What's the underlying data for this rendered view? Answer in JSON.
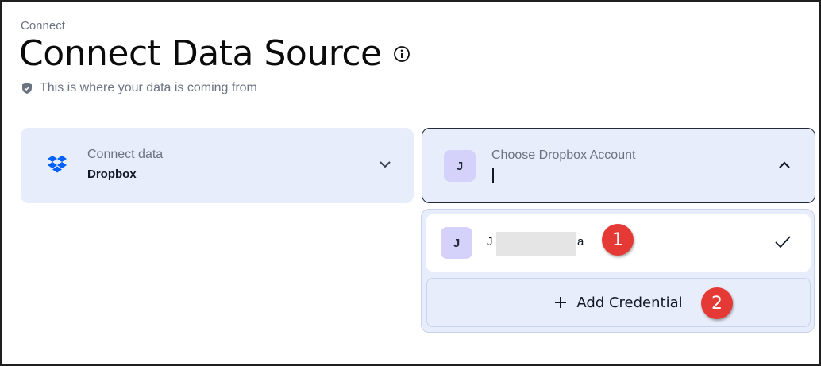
{
  "header": {
    "breadcrumb": "Connect",
    "title": "Connect Data Source",
    "subtitle": "This is where your data is coming from"
  },
  "source_card": {
    "label": "Connect data",
    "value": "Dropbox",
    "icon": "dropbox-icon"
  },
  "account_card": {
    "avatar_initial": "J",
    "label": "Choose Dropbox Account"
  },
  "dropdown": {
    "options": [
      {
        "avatar_initial": "J",
        "name_start": "J",
        "name_end": "a",
        "selected": true
      }
    ],
    "add_label": "Add Credential"
  },
  "annotations": [
    "1",
    "2"
  ],
  "colors": {
    "card_bg": "#e8edfb",
    "avatar_bg": "#d4d1fb",
    "dropbox_blue": "#0061fe",
    "badge_red": "#e53935"
  }
}
